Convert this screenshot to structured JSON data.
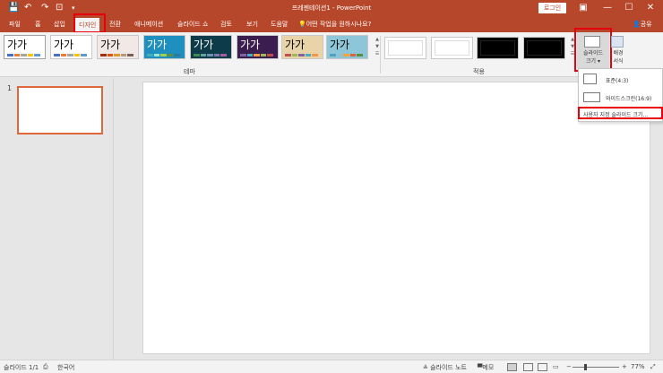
{
  "window": {
    "title": "프레젠테이션1 - PowerPoint",
    "login_label": "로그인",
    "save_icon": "💾",
    "undo_icon": "↶",
    "redo_icon": "↷",
    "slideshow_icon": "⊡",
    "customize_icon": "▾",
    "ribbon_display_icon": "▣",
    "minimize_icon": "—",
    "maximize_icon": "☐",
    "close_icon": "✕"
  },
  "tabs": [
    {
      "label": "파일"
    },
    {
      "label": "홈"
    },
    {
      "label": "삽입"
    },
    {
      "label": "디자인",
      "active": true
    },
    {
      "label": "전환"
    },
    {
      "label": "애니메이션"
    },
    {
      "label": "슬라이드 쇼"
    },
    {
      "label": "검토"
    },
    {
      "label": "보기"
    },
    {
      "label": "도움말"
    }
  ],
  "tell_me": "어떤 작업을 원하시나요?",
  "share_label": "공유",
  "ribbon": {
    "themes_group_label": "테마",
    "variants_group_label": "적용",
    "theme_sample_text": "가가",
    "slide_size_label_1": "슬라이드",
    "slide_size_label_2": "크기 ▾",
    "bg_format_label_1": "배경",
    "bg_format_label_2": "서식"
  },
  "theme_colors": [
    {
      "bg": "#ffffff",
      "fg": "#000000",
      "sw": [
        "#4472c4",
        "#ed7d31",
        "#a5a5a5",
        "#ffc000",
        "#5b9bd5"
      ]
    },
    {
      "bg": "#ffffff",
      "fg": "#000000",
      "sw": [
        "#4472c4",
        "#ed7d31",
        "#a5a5a5",
        "#ffc000",
        "#5b9bd5"
      ]
    },
    {
      "bg": "#f2e8e6",
      "fg": "#000000",
      "sw": [
        "#a5300f",
        "#d55816",
        "#e19825",
        "#b19c7d",
        "#7f5f52"
      ]
    },
    {
      "bg": "#1f8fbf",
      "fg": "#ffffff",
      "sw": [
        "#41aebd",
        "#97e9d5",
        "#a2cf49",
        "#608f3d",
        "#2f7a9c"
      ]
    },
    {
      "bg": "#0e3b4a",
      "fg": "#ffffff",
      "sw": [
        "#3e8853",
        "#62a39f",
        "#6992b1",
        "#7c79ae",
        "#a55f9e"
      ]
    },
    {
      "bg": "#3b1e4f",
      "fg": "#ffffff",
      "sw": [
        "#8064a2",
        "#4bacc6",
        "#f79646",
        "#9bbb59",
        "#c0504d"
      ]
    },
    {
      "bg": "#e8d4a8",
      "fg": "#000000",
      "sw": [
        "#c0504d",
        "#9bbb59",
        "#8064a2",
        "#4bacc6",
        "#f79646"
      ]
    },
    {
      "bg": "#8cc6d8",
      "fg": "#000000",
      "sw": [
        "#52a0bf",
        "#90c3d6",
        "#f4a338",
        "#dc6144",
        "#5d8e3d"
      ]
    }
  ],
  "variant_colors": [
    {
      "bg": "#ffffff",
      "inner": "#ffffff"
    },
    {
      "bg": "#ffffff",
      "inner": "#ffffff"
    },
    {
      "bg": "#000000",
      "inner": "#000000"
    },
    {
      "bg": "#000000",
      "inner": "#000000"
    }
  ],
  "thumbnail": {
    "number": "1"
  },
  "slide_size_menu": {
    "standard": "표준(4:3)",
    "widescreen": "와이드스크린(16:9)",
    "custom": "사용자 지정 슬라이드 크기..."
  },
  "status": {
    "slide_count": "슬라이드 1/1",
    "language": "한국어",
    "notes": "≗ 슬라이드 노트",
    "comments": "메모",
    "zoom_minus": "−",
    "zoom_plus": "+",
    "zoom": "77%"
  },
  "colors": {
    "accent": "#b7472a",
    "highlight": "#e8000b",
    "thumb_border": "#e0673c"
  }
}
